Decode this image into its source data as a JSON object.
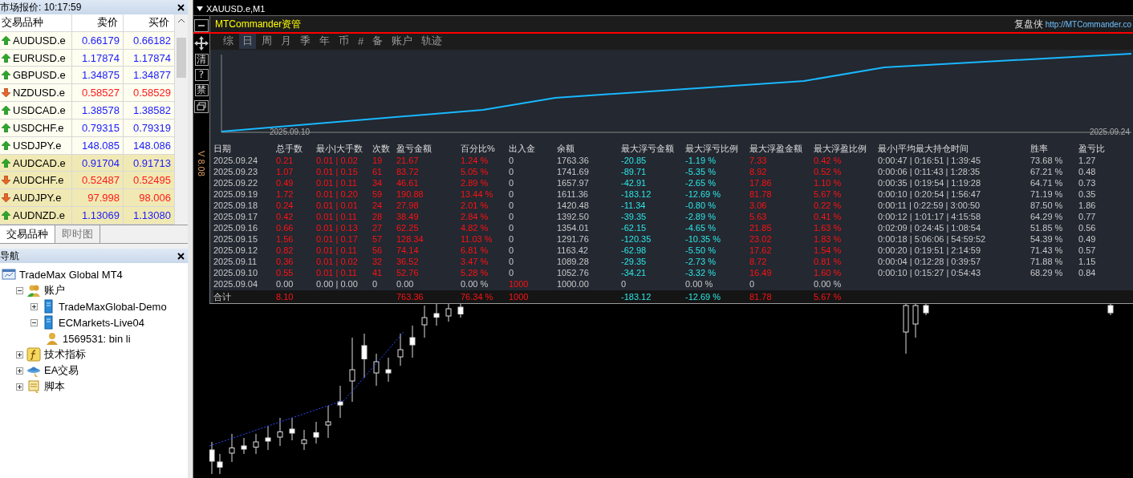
{
  "market_watch": {
    "title": "市场报价: 10:17:59",
    "columns": [
      "交易品种",
      "卖价",
      "买价"
    ],
    "rows": [
      {
        "symbol": "AUDUSD.e",
        "bid": "0.66179",
        "ask": "0.66182",
        "rising": true,
        "highlighted": false
      },
      {
        "symbol": "EURUSD.e",
        "bid": "1.17874",
        "ask": "1.17874",
        "rising": true,
        "highlighted": false
      },
      {
        "symbol": "GBPUSD.e",
        "bid": "1.34875",
        "ask": "1.34877",
        "rising": true,
        "highlighted": false
      },
      {
        "symbol": "NZDUSD.e",
        "bid": "0.58527",
        "ask": "0.58529",
        "rising": false,
        "highlighted": false
      },
      {
        "symbol": "USDCAD.e",
        "bid": "1.38578",
        "ask": "1.38582",
        "rising": true,
        "highlighted": false
      },
      {
        "symbol": "USDCHF.e",
        "bid": "0.79315",
        "ask": "0.79319",
        "rising": true,
        "highlighted": false
      },
      {
        "symbol": "USDJPY.e",
        "bid": "148.085",
        "ask": "148.086",
        "rising": true,
        "highlighted": false
      },
      {
        "symbol": "AUDCAD.e",
        "bid": "0.91704",
        "ask": "0.91713",
        "rising": true,
        "highlighted": true
      },
      {
        "symbol": "AUDCHF.e",
        "bid": "0.52487",
        "ask": "0.52495",
        "rising": false,
        "highlighted": true
      },
      {
        "symbol": "AUDJPY.e",
        "bid": "97.998",
        "ask": "98.006",
        "rising": false,
        "highlighted": true
      },
      {
        "symbol": "AUDNZD.e",
        "bid": "1.13069",
        "ask": "1.13080",
        "rising": true,
        "highlighted": true
      }
    ],
    "tabs": [
      {
        "label": "交易品种",
        "selected": true
      },
      {
        "label": "即时图",
        "selected": false
      }
    ]
  },
  "navigator": {
    "title": "导航",
    "tree": [
      {
        "label": "TradeMax Global MT4",
        "kind": "terminal",
        "children": [
          {
            "label": "账户",
            "kind": "accounts",
            "expanded": true,
            "children": [
              {
                "label": "TradeMaxGlobal-Demo",
                "kind": "server",
                "expanded": false
              },
              {
                "label": "ECMarkets-Live04",
                "kind": "server",
                "expanded": true,
                "children": [
                  {
                    "label": "1569531: bin li",
                    "kind": "user"
                  }
                ]
              }
            ]
          },
          {
            "label": "技术指标",
            "kind": "indicator",
            "expanded": false
          },
          {
            "label": "EA交易",
            "kind": "expert",
            "expanded": false
          },
          {
            "label": "脚本",
            "kind": "script",
            "expanded": false
          }
        ]
      }
    ]
  },
  "chart_window": {
    "title": "XAUUSD.e,M1",
    "side_buttons": [
      {
        "kind": "minimize"
      },
      {
        "kind": "move"
      },
      {
        "kind": "text",
        "label": "清"
      },
      {
        "kind": "text",
        "label": "?"
      },
      {
        "kind": "text",
        "label": "禁"
      },
      {
        "kind": "restore"
      }
    ],
    "version": "V 8.08",
    "panel": {
      "title": "MTCommander资管",
      "brand": "复盘侠",
      "link": "http://MTCommander.co",
      "tabs": [
        {
          "label": "综",
          "selected": false
        },
        {
          "label": "日",
          "selected": true
        },
        {
          "label": "周",
          "selected": false
        },
        {
          "label": "月",
          "selected": false
        },
        {
          "label": "季",
          "selected": false
        },
        {
          "label": "年",
          "selected": false
        },
        {
          "label": "币",
          "selected": false
        },
        {
          "label": "#",
          "selected": false
        },
        {
          "label": "备",
          "selected": false
        },
        {
          "label": "账户",
          "selected": false
        },
        {
          "label": "轨迹",
          "selected": false
        }
      ],
      "equity_chart": {
        "start_label": "2025.09.10",
        "end_label": "2025.09.24"
      },
      "table": {
        "columns": [
          "日期",
          "总手数",
          "最小|大手数",
          "次数",
          "盈亏金额",
          "百分比%",
          "出入金",
          "余额",
          "最大浮亏金额",
          "最大浮亏比例",
          "最大浮盈金额",
          "最大浮盈比例",
          "最小|平均最大持仓时间",
          "胜率",
          "盈亏比"
        ],
        "rows": [
          {
            "kind": "day",
            "cells": [
              "2025.09.24",
              "0.21",
              "0.01 | 0.02",
              "19",
              "21.67",
              "1.24 %",
              "0",
              "1763.36",
              "-20.85",
              "-1.19 %",
              "7.33",
              "0.42 %",
              "0:00:47 | 0:16:51 | 1:39:45",
              "73.68 %",
              "1.27"
            ]
          },
          {
            "kind": "day",
            "cells": [
              "2025.09.23",
              "1.07",
              "0.01 | 0.15",
              "61",
              "83.72",
              "5.05 %",
              "0",
              "1741.69",
              "-89.71",
              "-5.35 %",
              "8.92",
              "0.52 %",
              "0:00:06 | 0:11:43 | 1:28:35",
              "67.21 %",
              "0.48"
            ]
          },
          {
            "kind": "day",
            "cells": [
              "2025.09.22",
              "0.49",
              "0.01 | 0.11",
              "34",
              "46.61",
              "2.89 %",
              "0",
              "1657.97",
              "-42.91",
              "-2.65 %",
              "17.86",
              "1.10 %",
              "0:00:35 | 0:19:54 | 1:19:28",
              "64.71 %",
              "0.73"
            ]
          },
          {
            "kind": "day",
            "cells": [
              "2025.09.19",
              "1.72",
              "0.01 | 0.20",
              "59",
              "190.88",
              "13.44 %",
              "0",
              "1611.36",
              "-183.12",
              "-12.69 %",
              "81.78",
              "5.67 %",
              "0:00:10 | 0:20:54 | 1:56:47",
              "71.19 %",
              "0.35"
            ]
          },
          {
            "kind": "day",
            "cells": [
              "2025.09.18",
              "0.24",
              "0.01 | 0.01",
              "24",
              "27.98",
              "2.01 %",
              "0",
              "1420.48",
              "-11.34",
              "-0.80 %",
              "3.06",
              "0.22 %",
              "0:00:11 | 0:22:59 | 3:00:50",
              "87.50 %",
              "1.86"
            ]
          },
          {
            "kind": "day",
            "cells": [
              "2025.09.17",
              "0.42",
              "0.01 | 0.11",
              "28",
              "38.49",
              "2.84 %",
              "0",
              "1392.50",
              "-39.35",
              "-2.89 %",
              "5.63",
              "0.41 %",
              "0:00:12 | 1:01:17 | 4:15:58",
              "64.29 %",
              "0.77"
            ]
          },
          {
            "kind": "day",
            "cells": [
              "2025.09.16",
              "0.66",
              "0.01 | 0.13",
              "27",
              "62.25",
              "4.82 %",
              "0",
              "1354.01",
              "-62.15",
              "-4.65 %",
              "21.85",
              "1.63 %",
              "0:02:09 | 0:24:45 | 1:08:54",
              "51.85 %",
              "0.56"
            ]
          },
          {
            "kind": "day",
            "cells": [
              "2025.09.15",
              "1.56",
              "0.01 | 0.17",
              "57",
              "128.34",
              "11.03 %",
              "0",
              "1291.76",
              "-120.35",
              "-10.35 %",
              "23.02",
              "1.83 %",
              "0:00:18 | 5:06:06 | 54:59:52",
              "54.39 %",
              "0.49"
            ]
          },
          {
            "kind": "day",
            "cells": [
              "2025.09.12",
              "0.82",
              "0.01 | 0.11",
              "56",
              "74.14",
              "6.81 %",
              "0",
              "1163.42",
              "-62.98",
              "-5.50 %",
              "17.62",
              "1.54 %",
              "0:00:20 | 0:19:51 | 2:14:59",
              "71.43 %",
              "0.57"
            ]
          },
          {
            "kind": "day",
            "cells": [
              "2025.09.11",
              "0.36",
              "0.01 | 0.02",
              "32",
              "36.52",
              "3.47 %",
              "0",
              "1089.28",
              "-29.35",
              "-2.73 %",
              "8.72",
              "0.81 %",
              "0:00:04 | 0:12:28 | 0:39:57",
              "71.88 %",
              "1.15"
            ]
          },
          {
            "kind": "day",
            "cells": [
              "2025.09.10",
              "0.55",
              "0.01 | 0.11",
              "41",
              "52.76",
              "5.28 %",
              "0",
              "1052.76",
              "-34.21",
              "-3.32 %",
              "16.49",
              "1.60 %",
              "0:00:10 | 0:15:27 | 0:54:43",
              "68.29 %",
              "0.84"
            ]
          },
          {
            "kind": "flat",
            "cells": [
              "2025.09.04",
              "0.00",
              "0.00 | 0.00",
              "0",
              "0.00",
              "0.00 %",
              "1000",
              "1000.00",
              "0",
              "0.00 %",
              "0",
              "0.00 %",
              null,
              null,
              null
            ]
          },
          {
            "kind": "total",
            "cells": [
              "合计",
              "8.10",
              null,
              null,
              "763.36",
              "76.34 %",
              "1000",
              null,
              "-183.12",
              "-12.69 %",
              "81.78",
              "5.67 %",
              null,
              null,
              null
            ]
          }
        ]
      }
    }
  }
}
